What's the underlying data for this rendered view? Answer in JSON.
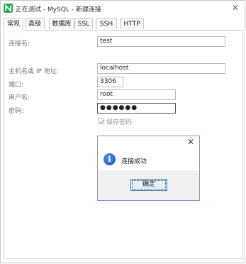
{
  "window": {
    "title": "正在测试 - MySQL - 新建连接",
    "close_glyph": "✕"
  },
  "tabs": [
    "常规",
    "高级",
    "数据库",
    "SSL",
    "SSH",
    "HTTP"
  ],
  "form": {
    "connection_name_label": "连接名:",
    "connection_name_value": "test",
    "host_label": "主机名或 IP 地址:",
    "host_value": "localhost",
    "port_label": "端口:",
    "port_value": "3306",
    "user_label": "用户名:",
    "user_value": "root",
    "password_label": "密码:",
    "password_value": "●●●●●●",
    "save_password_label": "保存密码",
    "save_password_checked": true
  },
  "dialog": {
    "message": "连接成功",
    "ok_label": "确定",
    "close_glyph": "✕",
    "icon": "info-icon",
    "icon_glyph": "i"
  },
  "colors": {
    "accent_green": "#2ea84e",
    "dialog_border": "#7a9ad6",
    "button_border": "#3c7fb1"
  }
}
